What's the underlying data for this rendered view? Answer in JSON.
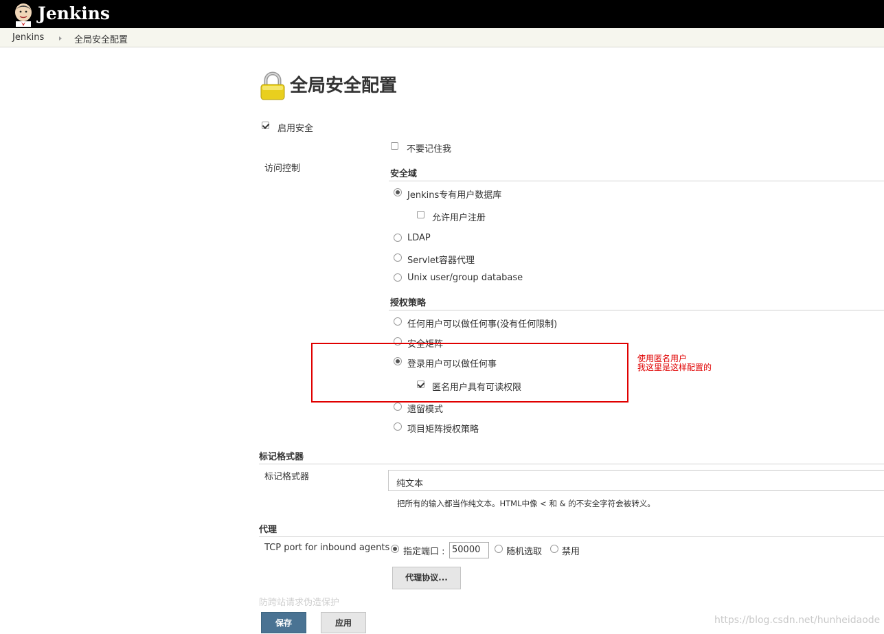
{
  "header": {
    "app_name": "Jenkins",
    "logo_icon": "jenkins-butler-icon",
    "background": "#000000"
  },
  "breadcrumb": {
    "items": [
      "Jenkins",
      "全局安全配置"
    ]
  },
  "page": {
    "title": "全局安全配置",
    "title_icon": "lock-icon"
  },
  "security": {
    "enable_security": {
      "label": "启用安全",
      "checked": true
    },
    "access_control_label": "访问控制",
    "dont_remember_me": {
      "label": "不要记住我",
      "checked": false
    },
    "realm": {
      "title": "安全域",
      "options": [
        {
          "label": "Jenkins专有用户数据库",
          "selected": true
        },
        {
          "label": "LDAP",
          "selected": false
        },
        {
          "label": "Servlet容器代理",
          "selected": false
        },
        {
          "label": "Unix user/group database",
          "selected": false
        }
      ],
      "allow_signup": {
        "label": "允许用户注册",
        "checked": false
      }
    },
    "authorization": {
      "title": "授权策略",
      "options": [
        {
          "label": "任何用户可以做任何事(没有任何限制)",
          "selected": false
        },
        {
          "label": "安全矩阵",
          "selected": false
        },
        {
          "label": "登录用户可以做任何事",
          "selected": true
        },
        {
          "label": "遗留模式",
          "selected": false
        },
        {
          "label": "项目矩阵授权策略",
          "selected": false
        }
      ],
      "anonymous_read": {
        "label": "匿名用户具有可读权限",
        "checked": true
      }
    }
  },
  "annotation": {
    "line1": "使用匿名用户",
    "line2": "我这里是这样配置的",
    "color": "#e00000"
  },
  "markup": {
    "section_title": "标记格式器",
    "field_label": "标记格式器",
    "selected_value": "纯文本",
    "help": "把所有的输入都当作纯文本。HTML中像 < 和 & 的不安全字符会被转义。"
  },
  "agents": {
    "section_title": "代理",
    "field_label": "TCP port for inbound agents",
    "fixed_label": "指定端口 :",
    "port_value": "50000",
    "random_label": "随机选取",
    "disable_label": "禁用",
    "protocols_button": "代理协议..."
  },
  "partial_text": "防跨站请求伪造保护",
  "footer": {
    "save": "保存",
    "apply": "应用"
  },
  "watermark": "https://blog.csdn.net/hunheidaode",
  "colors": {
    "primary_button": "#4a7393",
    "breadcrumb_bg": "#f6f6ee"
  }
}
